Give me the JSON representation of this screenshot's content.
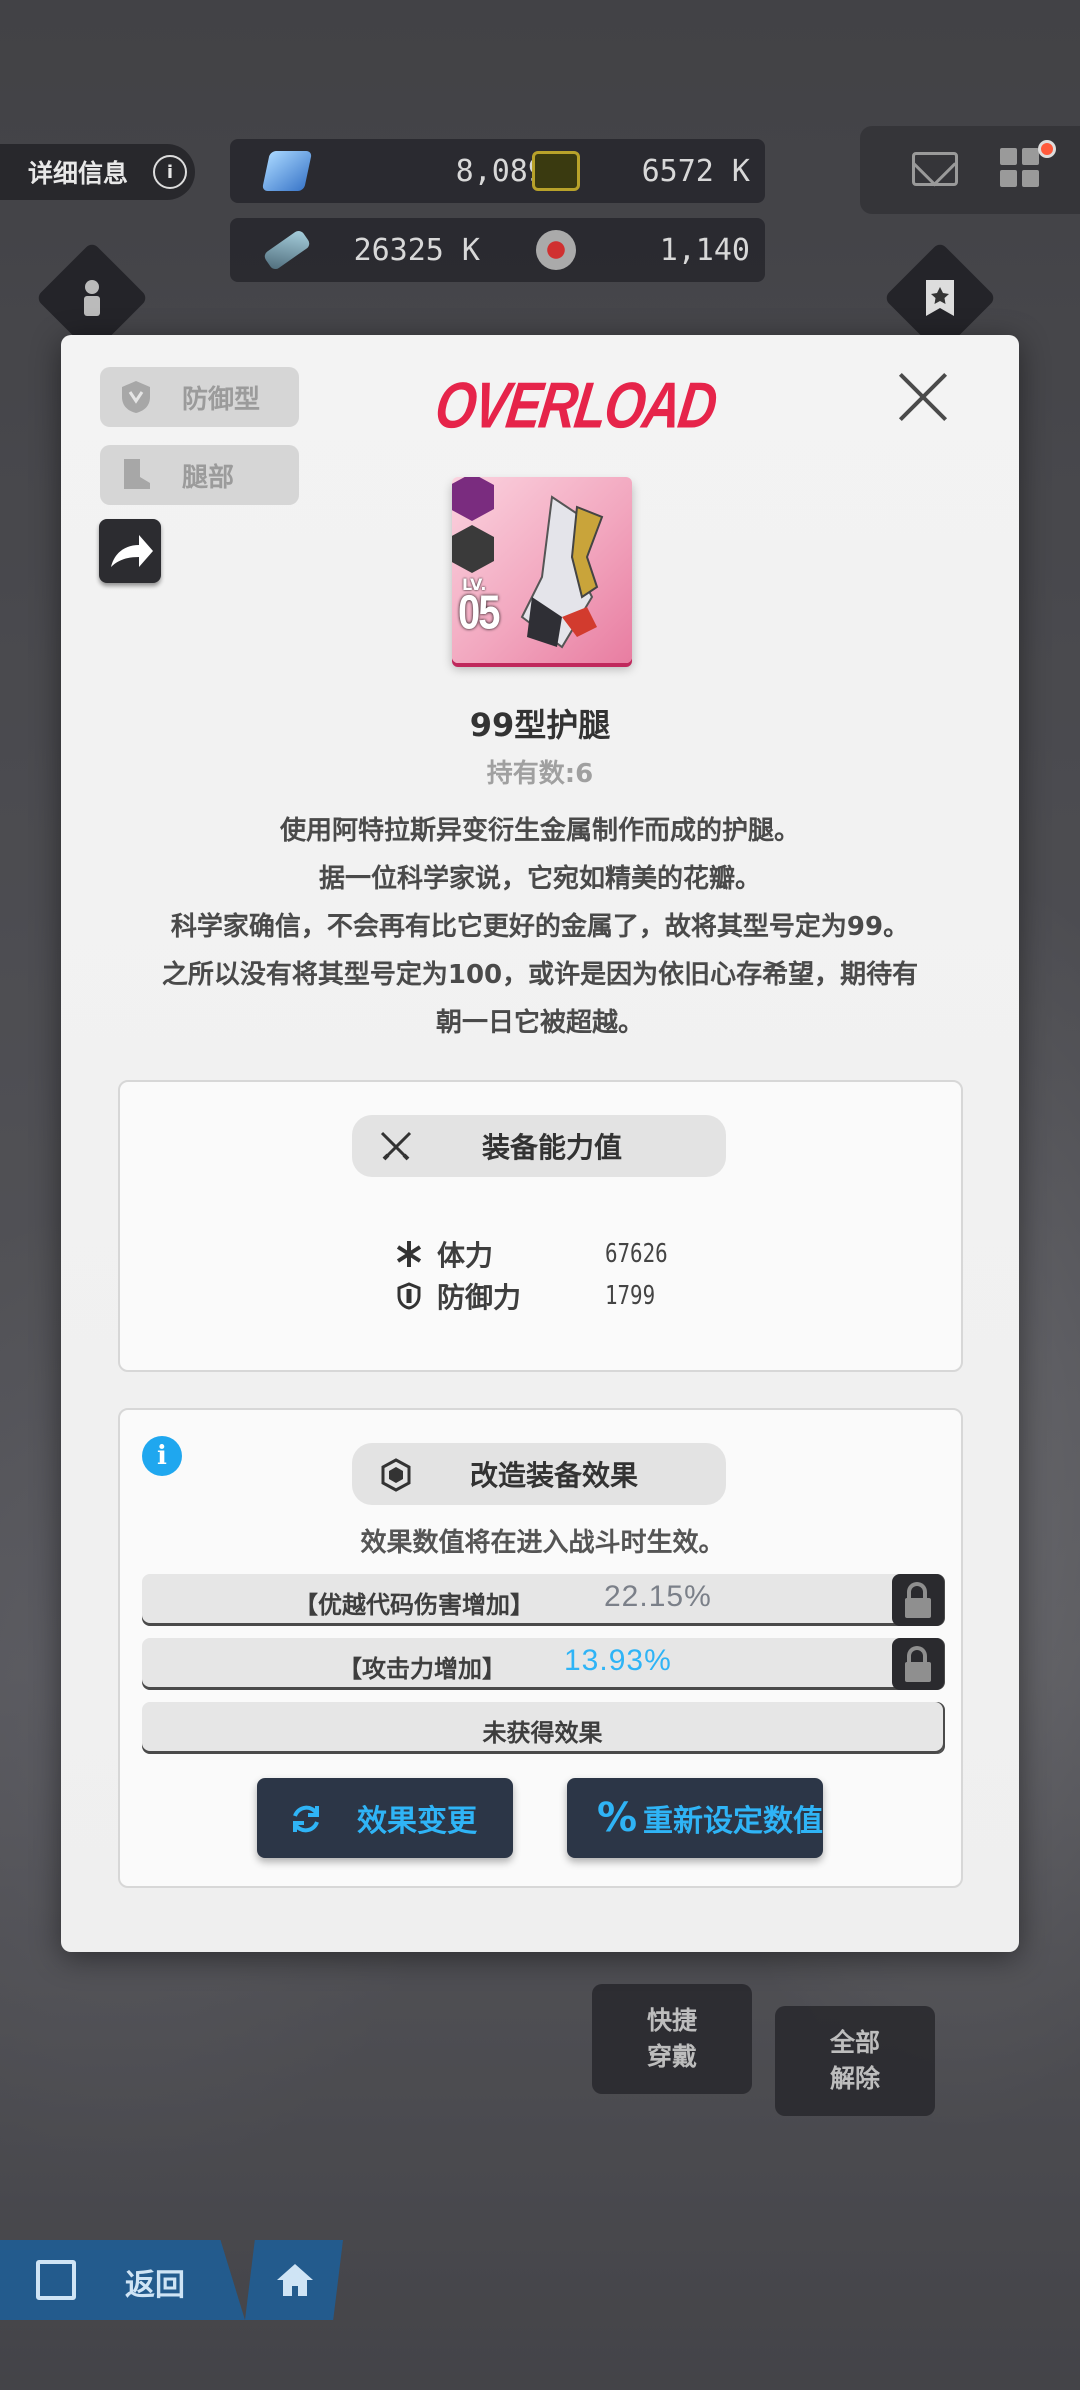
{
  "hud": {
    "detail_label": "详细信息",
    "info_glyph": "i",
    "resources": [
      {
        "icon": "gem-icon",
        "value": "8,089",
        "plus": "+"
      },
      {
        "icon": "credit-card-icon",
        "value": "6572 K"
      },
      {
        "icon": "battle-data-icon",
        "value": "26325 K"
      },
      {
        "icon": "core-dust-icon",
        "value": "1,140"
      }
    ],
    "notification_color": "#ff5a3c"
  },
  "modal": {
    "tags": [
      {
        "icon": "shield-class-icon",
        "label": "防御型"
      },
      {
        "icon": "boot-icon",
        "label": "腿部"
      }
    ],
    "logo": "OVERLOAD",
    "item": {
      "level_label": "LV.",
      "level": "05",
      "name": "99型护腿",
      "count": "持有数:6",
      "rarity_color": "#e87da1"
    },
    "description": [
      "使用阿特拉斯异变衍生金属制作而成的护腿。",
      "据一位科学家说，它宛如精美的花瓣。",
      "科学家确信，不会再有比它更好的金属了，故将其型号定为99。",
      "之所以没有将其型号定为100，或许是因为依旧心存希望，期待有",
      "朝一日它被超越。"
    ],
    "stats_panel": {
      "title": "装备能力值",
      "stats": [
        {
          "icon": "asterisk-icon",
          "name": "体力",
          "value": "67626"
        },
        {
          "icon": "shield-icon",
          "name": "防御力",
          "value": "1799"
        }
      ]
    },
    "effects_panel": {
      "title": "改造装备效果",
      "note": "效果数值将在进入战斗时生效。",
      "effects": [
        {
          "name": "【优越代码伤害增加】",
          "value": "22.15%",
          "value_color": "#7b8089",
          "locked": true
        },
        {
          "name": "【攻击力增加】",
          "value": "13.93%",
          "value_color": "#2fb4f6",
          "locked": true
        },
        {
          "name": "未获得效果",
          "value": "",
          "locked": false
        }
      ],
      "buttons": [
        {
          "icon": "refresh-icon",
          "label": "效果变更"
        },
        {
          "icon": "percent-icon",
          "label": "重新设定数值"
        }
      ],
      "accent_color": "#2fb4f6"
    }
  },
  "bottom": {
    "back_label": "返回",
    "quick_equip": [
      "快捷",
      "穿戴"
    ],
    "unequip_all": [
      "全部",
      "解除"
    ]
  }
}
